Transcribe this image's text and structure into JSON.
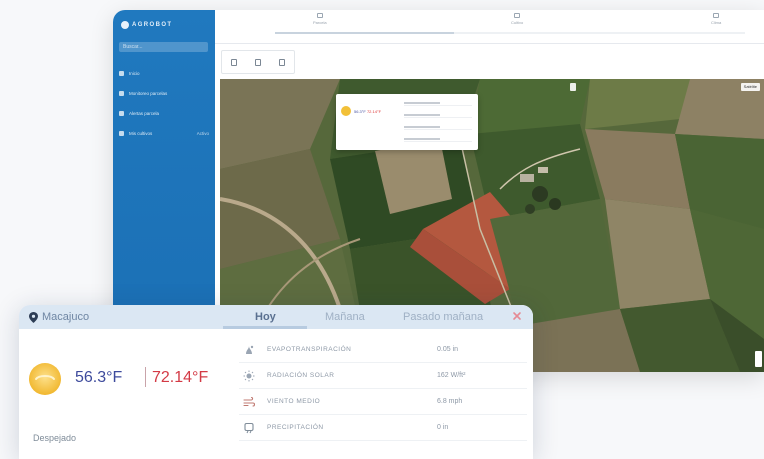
{
  "app": {
    "brand": "AGROBOT",
    "search_placeholder": "Buscar...",
    "nav": [
      {
        "label": "Inicio"
      },
      {
        "label": "Monitoreo parcelas"
      },
      {
        "label": "Alertas parcela"
      },
      {
        "label": "Mis cultivos",
        "badge": "Activo"
      }
    ],
    "top_tabs": [
      {
        "label": "Parcela"
      },
      {
        "label": "Cultivo"
      },
      {
        "label": "Clima"
      }
    ]
  },
  "weather": {
    "location": "Macajuco",
    "tabs": [
      {
        "label": "Hoy",
        "active": true
      },
      {
        "label": "Mañana",
        "active": false
      },
      {
        "label": "Pasado mañana",
        "active": false
      }
    ],
    "temp_min": "56.3°F",
    "temp_max": "72.14°F",
    "condition": "Despejado",
    "metrics": [
      {
        "label": "EVAPOTRANSPIRACIÓN",
        "value": "0.05 in",
        "icon": "evapotranspiration-icon"
      },
      {
        "label": "RADIACIÓN SOLAR",
        "value": "162 W/ft²",
        "icon": "solar-radiation-icon"
      },
      {
        "label": "VIENTO MEDIO",
        "value": "6.8 mph",
        "icon": "wind-icon"
      },
      {
        "label": "PRECIPITACIÓN",
        "value": "0 in",
        "icon": "precipitation-icon"
      }
    ],
    "colors": {
      "min_temp": "#3d4a9c",
      "max_temp": "#d33a45",
      "header": "#dbe7f3"
    }
  },
  "mini_popup": {
    "temp_min": "56.3°F",
    "temp_max": "72.14°F"
  },
  "map": {
    "highlight_color": "#b4583f",
    "view": "Satélite"
  }
}
